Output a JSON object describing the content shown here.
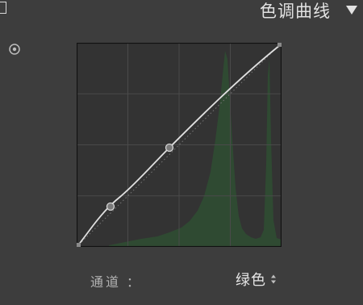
{
  "header": {
    "title": "色调曲线"
  },
  "icons": {
    "collapse": "square-toggle-icon",
    "menu_arrow": "triangle-down-icon",
    "target_adjust": "target-adjust-icon",
    "select_arrows": "updown-arrows-icon"
  },
  "channel": {
    "label": "通道",
    "colon": "：",
    "selected": "绿色"
  },
  "colors": {
    "panel_bg": "#3d3d3d",
    "grid_bg": "#333333",
    "histogram": "#2f4a32",
    "curve": "#e0e0e0"
  },
  "curve": {
    "control_points": [
      {
        "input": 0,
        "output": 0
      },
      {
        "input": 0.16,
        "output": 0.2
      },
      {
        "input": 0.45,
        "output": 0.49
      },
      {
        "input": 1,
        "output": 1
      }
    ]
  }
}
